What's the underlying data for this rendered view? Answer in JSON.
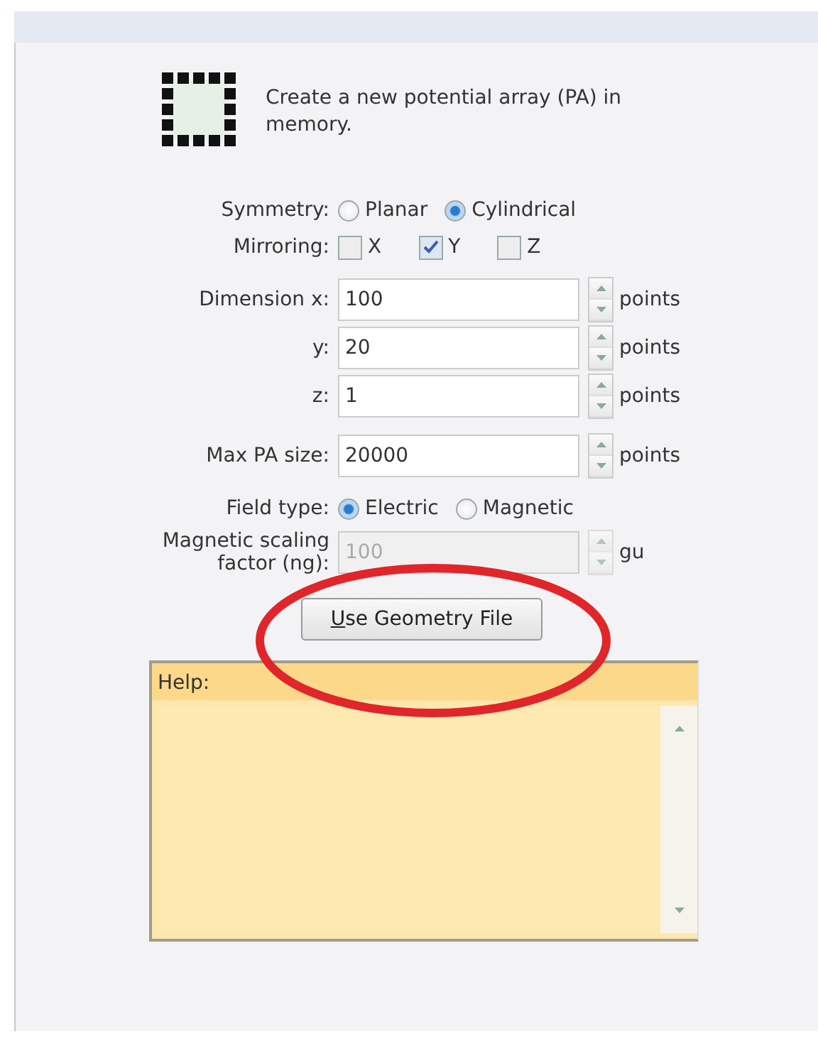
{
  "description": "Create a new potential array (PA) in memory.",
  "rows": [
    {
      "kind": "radio",
      "label": "Symmetry:",
      "options": [
        {
          "label": "Planar",
          "selected": false
        },
        {
          "label": "Cylindrical",
          "selected": true
        }
      ]
    },
    {
      "kind": "checks",
      "label": "Mirroring:",
      "options": [
        {
          "label": "X",
          "checked": false
        },
        {
          "label": "Y",
          "checked": true
        },
        {
          "label": "Z",
          "checked": false
        }
      ]
    },
    {
      "kind": "spin",
      "label": "Dimension x:",
      "value": "100",
      "unit": "points",
      "disabled": false
    },
    {
      "kind": "spin",
      "label": "y:",
      "value": "20",
      "unit": "points",
      "disabled": false
    },
    {
      "kind": "spin",
      "label": "z:",
      "value": "1",
      "unit": "points",
      "disabled": false
    },
    {
      "kind": "spin",
      "label": "Max PA size:",
      "value": "20000",
      "unit": "points",
      "disabled": false
    },
    {
      "kind": "radio",
      "label": "Field type:",
      "options": [
        {
          "label": "Electric",
          "selected": true
        },
        {
          "label": "Magnetic",
          "selected": false
        }
      ]
    },
    {
      "kind": "spin",
      "label": "Magnetic scaling factor (ng):",
      "value": "100",
      "unit": "gu",
      "disabled": true
    }
  ],
  "button": {
    "label": "Use Geometry File",
    "mnemonic_first": true
  },
  "help": {
    "title": "Help:"
  }
}
